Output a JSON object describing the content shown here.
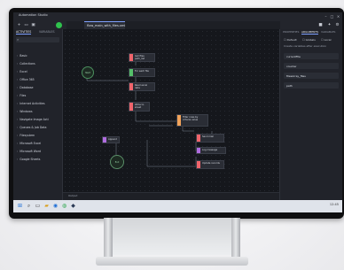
{
  "window": {
    "app_name": "Automation Studio",
    "controls": [
      "–",
      "□",
      "×"
    ]
  },
  "toolbar": {
    "icons": [
      "plus-icon",
      "folder-icon",
      "save-icon"
    ],
    "run_color": "#2fc24d"
  },
  "tabs": [
    {
      "label": "flow_main_with_files.xml"
    }
  ],
  "left_panel": {
    "tabs": [
      {
        "label": "ACTIVITIES",
        "active": true
      },
      {
        "label": "VARIABLES",
        "active": false
      }
    ],
    "search_placeholder": "",
    "items": [
      {
        "label": "Basic"
      },
      {
        "label": "Collections"
      },
      {
        "label": "Excel"
      },
      {
        "label": "Office 365"
      },
      {
        "label": "Database"
      },
      {
        "label": "Files"
      },
      {
        "label": "Internet Activities"
      },
      {
        "label": "Windows"
      },
      {
        "label": "Navigate Image Acti"
      },
      {
        "label": "Queues & Job Data"
      },
      {
        "label": "Filesystem"
      },
      {
        "label": "Microsoft Excel"
      },
      {
        "label": "Microsoft Word"
      },
      {
        "label": "Google Sheets"
      }
    ]
  },
  "canvas": {
    "start_label": "Start",
    "end_label": "End",
    "nodes": [
      {
        "title": "Get files path_list"
      },
      {
        "title": "For each file"
      },
      {
        "title": "Read excel data"
      },
      {
        "title": "Write to sheet"
      },
      {
        "title": "Filter rows by criteria value"
      },
      {
        "title": "Append"
      },
      {
        "title": "Send mail"
      },
      {
        "title": "Log message"
      },
      {
        "title": "Update records"
      }
    ],
    "colors": {
      "red": "#f0646b",
      "green": "#55c06a",
      "orange": "#f2a35a",
      "purple": "#b06ce0"
    }
  },
  "bottombar": {
    "label": "Output"
  },
  "right_panel": {
    "tabs": [
      {
        "label": "PROPERTIES",
        "active": false
      },
      {
        "label": "ARGUMENTS",
        "active": true
      },
      {
        "label": "VARIABLES",
        "active": false
      }
    ],
    "checks": [
      "Default",
      "Globals",
      "Local"
    ],
    "note": "Create variables after execution",
    "fields": [
      {
        "label": "currentFile"
      },
      {
        "label": "counter"
      },
      {
        "label": "filesArray_files"
      },
      {
        "label": "path"
      }
    ]
  },
  "taskbar": {
    "tray": "12:45"
  }
}
